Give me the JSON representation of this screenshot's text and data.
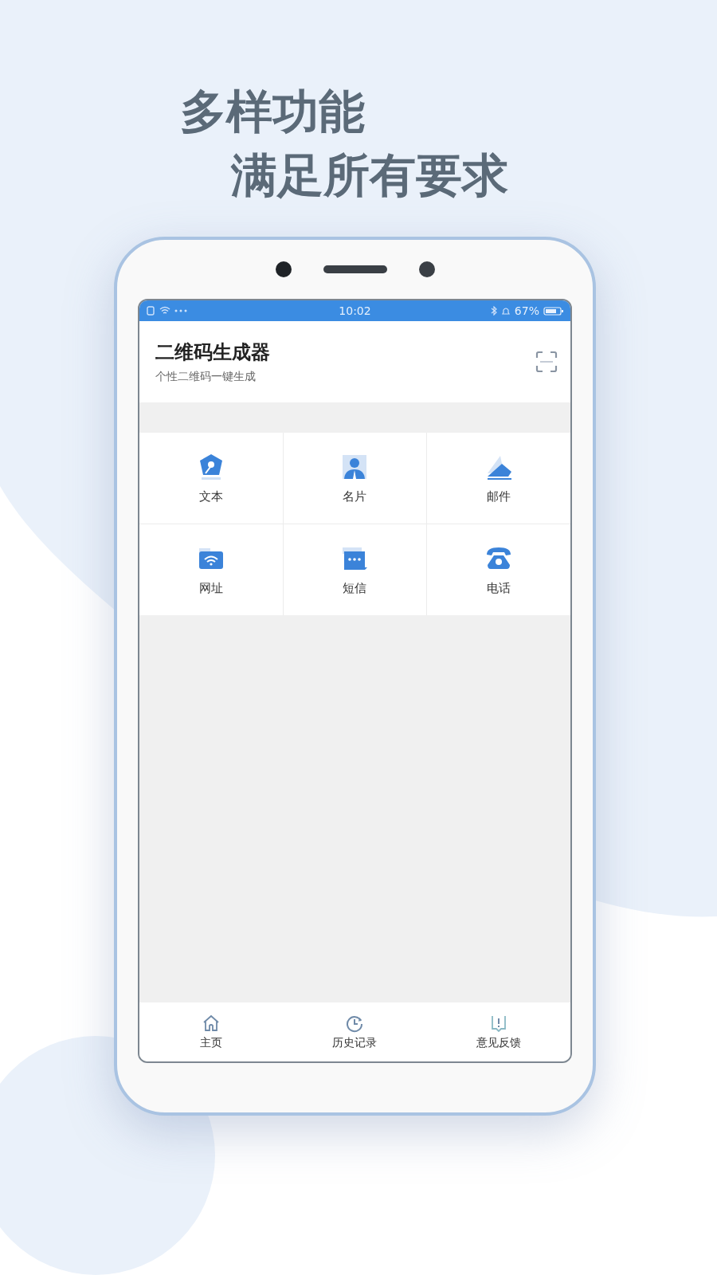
{
  "headline": [
    "多样功能",
    "满足所有要求"
  ],
  "status_bar": {
    "time": "10:02",
    "battery_text": "67%"
  },
  "app": {
    "title": "二维码生成器",
    "subtitle": "个性二维码一键生成"
  },
  "features": [
    {
      "label": "文本"
    },
    {
      "label": "名片"
    },
    {
      "label": "邮件"
    },
    {
      "label": "网址"
    },
    {
      "label": "短信"
    },
    {
      "label": "电话"
    }
  ],
  "nav": [
    {
      "label": "主页"
    },
    {
      "label": "历史记录"
    },
    {
      "label": "意见反馈"
    }
  ]
}
